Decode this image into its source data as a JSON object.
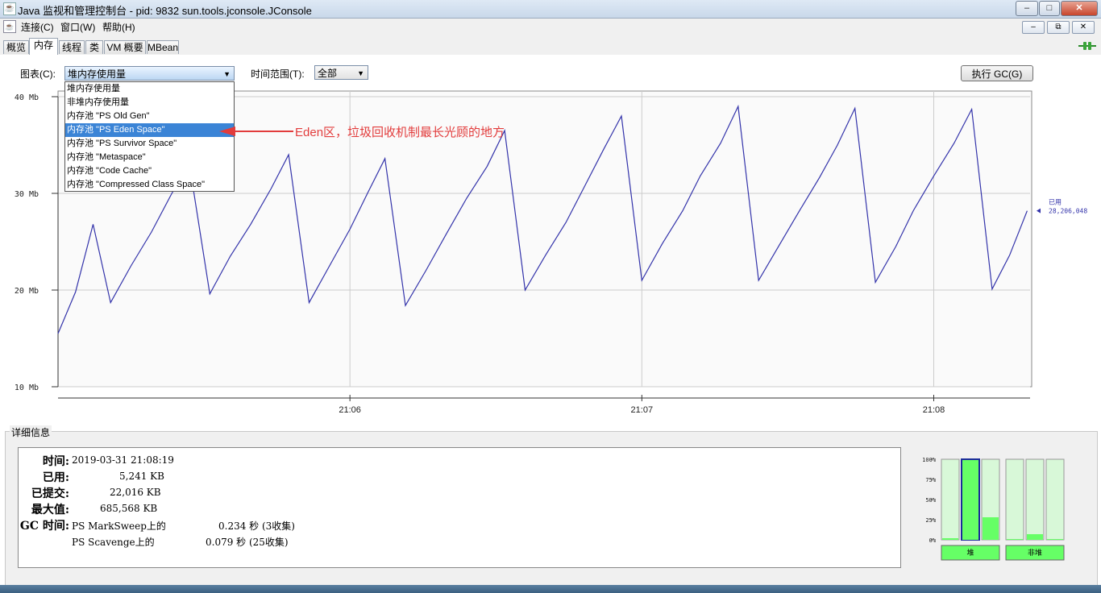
{
  "window": {
    "title": "Java 监视和管理控制台 - pid: 9832 sun.tools.jconsole.JConsole",
    "minimize": "–",
    "maximize": "□",
    "close": "✕"
  },
  "menubar": {
    "items": [
      "连接(C)",
      "窗口(W)",
      "帮助(H)"
    ],
    "mdi_buttons": [
      "–",
      "⧉",
      "✕"
    ]
  },
  "tabs": [
    "概览",
    "内存",
    "线程",
    "类",
    "VM 概要",
    "MBean"
  ],
  "controls": {
    "chart_label": "图表(C):",
    "chart_selected": "堆内存使用量",
    "range_label": "时间范围(T):",
    "range_selected": "全部",
    "gc_button": "执行 GC(G)"
  },
  "dropdown": {
    "options": [
      "堆内存使用量",
      "非堆内存使用量",
      "内存池 \"PS Old Gen\"",
      "内存池 \"PS Eden Space\"",
      "内存池 \"PS Survivor Space\"",
      "内存池 \"Metaspace\"",
      "内存池 \"Code Cache\"",
      "内存池 \"Compressed Class Space\""
    ],
    "selected_index": 3
  },
  "annotation": {
    "text": "Eden区，垃圾回收机制最长光顾的地方",
    "color": "#e23c3c"
  },
  "chart_data": {
    "type": "line",
    "y_ticks": [
      "40 Mb",
      "30 Mb",
      "20 Mb",
      "10 Mb"
    ],
    "ylim": [
      10,
      40
    ],
    "x_ticks": [
      "21:06",
      "21:07",
      "21:08"
    ],
    "x_tick_positions": [
      1.0,
      2.0,
      3.0
    ],
    "xlim": [
      0,
      3.33
    ],
    "grid": true,
    "series": [
      {
        "color": "#3333aa",
        "points": [
          [
            0.0,
            15.5
          ],
          [
            0.06,
            19.8
          ],
          [
            0.12,
            26.8
          ],
          [
            0.18,
            18.7
          ],
          [
            0.25,
            22.5
          ],
          [
            0.32,
            26.0
          ],
          [
            0.39,
            30.0
          ],
          [
            0.45,
            33.0
          ],
          [
            0.52,
            19.6
          ],
          [
            0.59,
            23.5
          ],
          [
            0.66,
            26.8
          ],
          [
            0.73,
            30.5
          ],
          [
            0.79,
            34.0
          ],
          [
            0.86,
            18.7
          ],
          [
            0.93,
            22.5
          ],
          [
            1.0,
            26.3
          ],
          [
            1.06,
            30.0
          ],
          [
            1.12,
            33.6
          ],
          [
            1.19,
            18.4
          ],
          [
            1.26,
            22.0
          ],
          [
            1.33,
            25.8
          ],
          [
            1.4,
            29.5
          ],
          [
            1.47,
            32.8
          ],
          [
            1.53,
            36.5
          ],
          [
            1.6,
            20.0
          ],
          [
            1.67,
            23.6
          ],
          [
            1.74,
            27.0
          ],
          [
            1.8,
            30.5
          ],
          [
            1.87,
            34.6
          ],
          [
            1.93,
            38.0
          ],
          [
            2.0,
            21.0
          ],
          [
            2.07,
            24.8
          ],
          [
            2.14,
            28.2
          ],
          [
            2.2,
            31.8
          ],
          [
            2.27,
            35.2
          ],
          [
            2.33,
            39.0
          ],
          [
            2.4,
            21.0
          ],
          [
            2.47,
            24.6
          ],
          [
            2.54,
            28.2
          ],
          [
            2.61,
            31.7
          ],
          [
            2.67,
            35.0
          ],
          [
            2.73,
            38.8
          ],
          [
            2.8,
            20.8
          ],
          [
            2.87,
            24.5
          ],
          [
            2.93,
            28.2
          ],
          [
            3.0,
            31.8
          ],
          [
            3.07,
            35.2
          ],
          [
            3.13,
            38.7
          ],
          [
            3.2,
            20.1
          ],
          [
            3.26,
            23.6
          ],
          [
            3.32,
            28.2
          ]
        ]
      }
    ],
    "current_label": "已用",
    "current_value": "28,206,048"
  },
  "details": {
    "title": "详细信息",
    "rows": [
      {
        "key": "时间:",
        "value": "2019-03-31 21:08:19"
      },
      {
        "key": "已用:",
        "value": "5,241 KB"
      },
      {
        "key": "已提交:",
        "value": "22,016 KB"
      },
      {
        "key": "最大值:",
        "value": "685,568 KB"
      },
      {
        "key": "GC 时间:",
        "value": "PS MarkSweep上的",
        "extra": "0.234 秒 (3收集)"
      },
      {
        "key": "",
        "value": "PS Scavenge上的",
        "extra": "0.079 秒 (25收集)"
      }
    ]
  },
  "pool_bars": {
    "y_ticks": [
      "100%",
      "75%",
      "50%",
      "25%",
      "0%"
    ],
    "heap_levels": [
      0.02,
      0.99,
      0.28
    ],
    "nonheap_levels": [
      0.0,
      0.07,
      0.0
    ],
    "heap_label": "堆",
    "nonheap_label": "非堆"
  },
  "colors": {
    "fill": "#66ff66",
    "fill_light": "#d8f8d8",
    "line": "#3333aa"
  }
}
